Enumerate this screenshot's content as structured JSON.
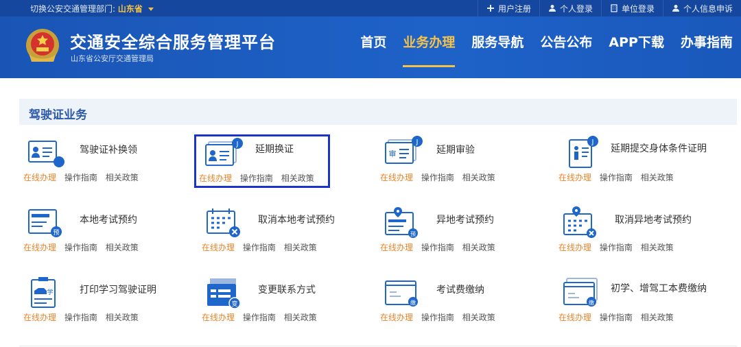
{
  "topbar": {
    "switch_label": "切换公安交通管理部门:",
    "province": "山东省",
    "links": [
      {
        "label": "用户注册",
        "icon": "plus-icon"
      },
      {
        "label": "个人登录",
        "icon": "user-icon"
      },
      {
        "label": "单位登录",
        "icon": "building-icon"
      },
      {
        "label": "个人信息申诉",
        "icon": "user-icon"
      }
    ]
  },
  "header": {
    "title": "交通安全综合服务管理平台",
    "subtitle": "山东省公安厅交通管理局",
    "nav": [
      "首页",
      "业务办理",
      "服务导航",
      "公告公布",
      "APP下载",
      "办事指南"
    ],
    "active_nav": 1
  },
  "section": {
    "title": "驾驶证业务"
  },
  "actions": {
    "online": "在线办理",
    "guide": "操作指南",
    "policy": "相关政策"
  },
  "services": [
    {
      "name": "驾驶证补换领",
      "icon": "license-card-icon"
    },
    {
      "name": "延期换证",
      "icon": "license-card-extend-icon"
    },
    {
      "name": "延期审验",
      "icon": "review-card-icon"
    },
    {
      "name": "延期提交身体条件证明",
      "icon": "health-certificate-icon"
    },
    {
      "name": "本地考试预约",
      "icon": "exam-booking-icon"
    },
    {
      "name": "取消本地考试预约",
      "icon": "calendar-cancel-icon"
    },
    {
      "name": "异地考试预约",
      "icon": "remote-exam-booking-icon"
    },
    {
      "name": "取消异地考试预约",
      "icon": "remote-calendar-cancel-icon"
    },
    {
      "name": "打印学习驾驶证明",
      "icon": "learner-print-icon"
    },
    {
      "name": "变更联系方式",
      "icon": "contact-change-icon"
    },
    {
      "name": "考试费缴纳",
      "icon": "exam-fee-icon"
    },
    {
      "name": "初学、增驾工本费缴纳",
      "icon": "fee-payment-icon"
    }
  ],
  "colors": {
    "header": "#1a55b5",
    "accent": "#f3c24c",
    "online": "#e8842a",
    "highlight": "#1d33c8"
  }
}
